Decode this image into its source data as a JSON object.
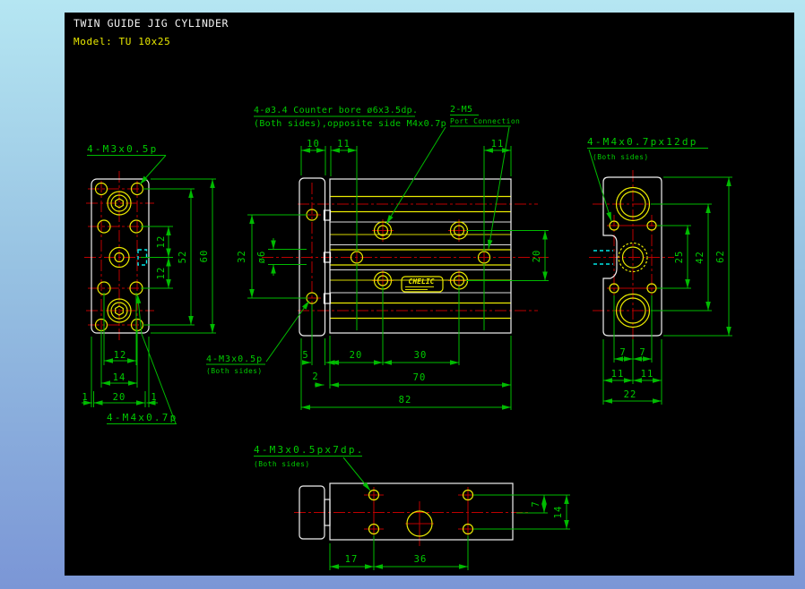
{
  "title": "TWIN GUIDE JIG CYLINDER",
  "model": "Model: TU 10x25",
  "logo": "CHELIC",
  "labels": {
    "m3_top": "4-M3x0.5p",
    "m4_bottom": "4-M4x0.7p",
    "cb1": "4-ø3.4 Counter bore ø6x3.5dp.",
    "cb2": "(Both sides),opposite side M4x0.7p",
    "port1": "2-M5",
    "port2": "Port Connection",
    "m3_both1": "4-M3x0.5p",
    "m3_both2": "(Both sides)",
    "right1": "4-M4x0.7px12dp",
    "right2": "(Both sides)",
    "bottom1": "4-M3x0.5px7dp.",
    "bottom2": "(Both sides)"
  },
  "dims": {
    "l12a": "12",
    "l12b": "12",
    "l52": "52",
    "l60": "60",
    "l12h": "12",
    "l14": "14",
    "l20": "20",
    "l1a": "1",
    "l1b": "1",
    "m10": "10",
    "m11a": "11",
    "m11b": "11",
    "m32": "32",
    "mdia6": "ø6",
    "m20v": "20",
    "m5": "5",
    "m20": "20",
    "m30": "30",
    "m2": "2",
    "m70": "70",
    "m82": "82",
    "r25": "25",
    "r42": "42",
    "r62": "62",
    "r7a": "7",
    "r7b": "7",
    "r11a": "11",
    "r11b": "11",
    "r22": "22",
    "b7": "7",
    "b14": "14",
    "b17": "17",
    "b36": "36"
  },
  "colors": {
    "dimension_green": "#00bb00",
    "geometry_white": "#f0f0f0",
    "hole_yellow": "#e9e900",
    "centerline_red": "#bd0000",
    "highlight_cyan": "#00e8e8",
    "canvas_black": "#000000",
    "frame_top": "#b5e6f2",
    "frame_bottom": "#7b96d6"
  }
}
